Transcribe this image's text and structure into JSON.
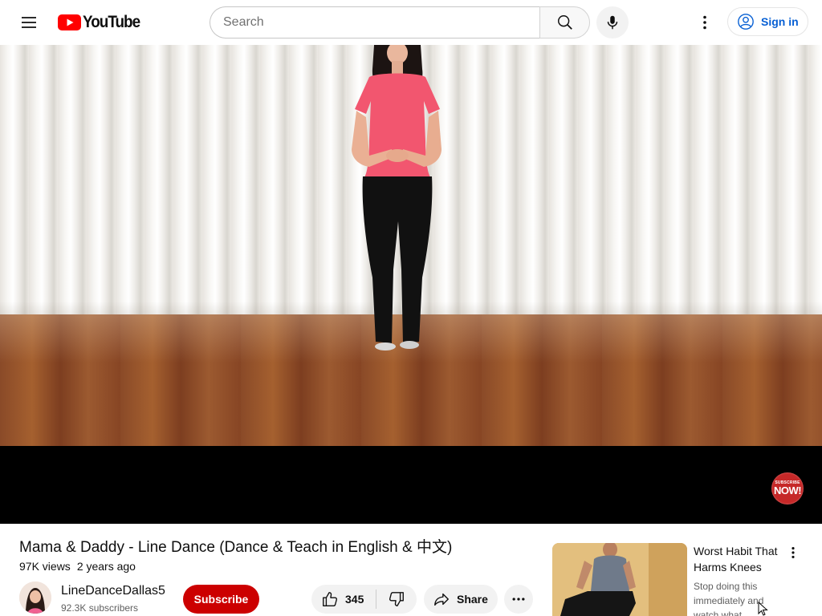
{
  "header": {
    "logo_text": "YouTube",
    "search": {
      "placeholder": "Search",
      "value": ""
    },
    "signin_label": "Sign in",
    "icons": [
      "menu-icon",
      "youtube-logo-icon",
      "search-icon",
      "mic-icon",
      "more-vert-icon",
      "account-icon"
    ]
  },
  "player": {
    "badge_line1": "SUBSCRIBE",
    "badge_line2": "NOW!"
  },
  "video": {
    "title": "Mama & Daddy - Line Dance (Dance & Teach in English & 中文)",
    "views": "97K views",
    "age": "2 years ago"
  },
  "channel": {
    "name": "LineDanceDallas5",
    "subscribers": "92.3K subscribers",
    "subscribe_label": "Subscribe"
  },
  "actions": {
    "like_count": "345",
    "share_label": "Share"
  },
  "recommended": [
    {
      "title": "Worst Habit That Harms Knees",
      "description": "Stop doing this immediately and watch what"
    }
  ],
  "colors": {
    "brand_red": "#ff0000",
    "subscribe_bg": "#cc0000",
    "link_blue": "#065fd4"
  }
}
